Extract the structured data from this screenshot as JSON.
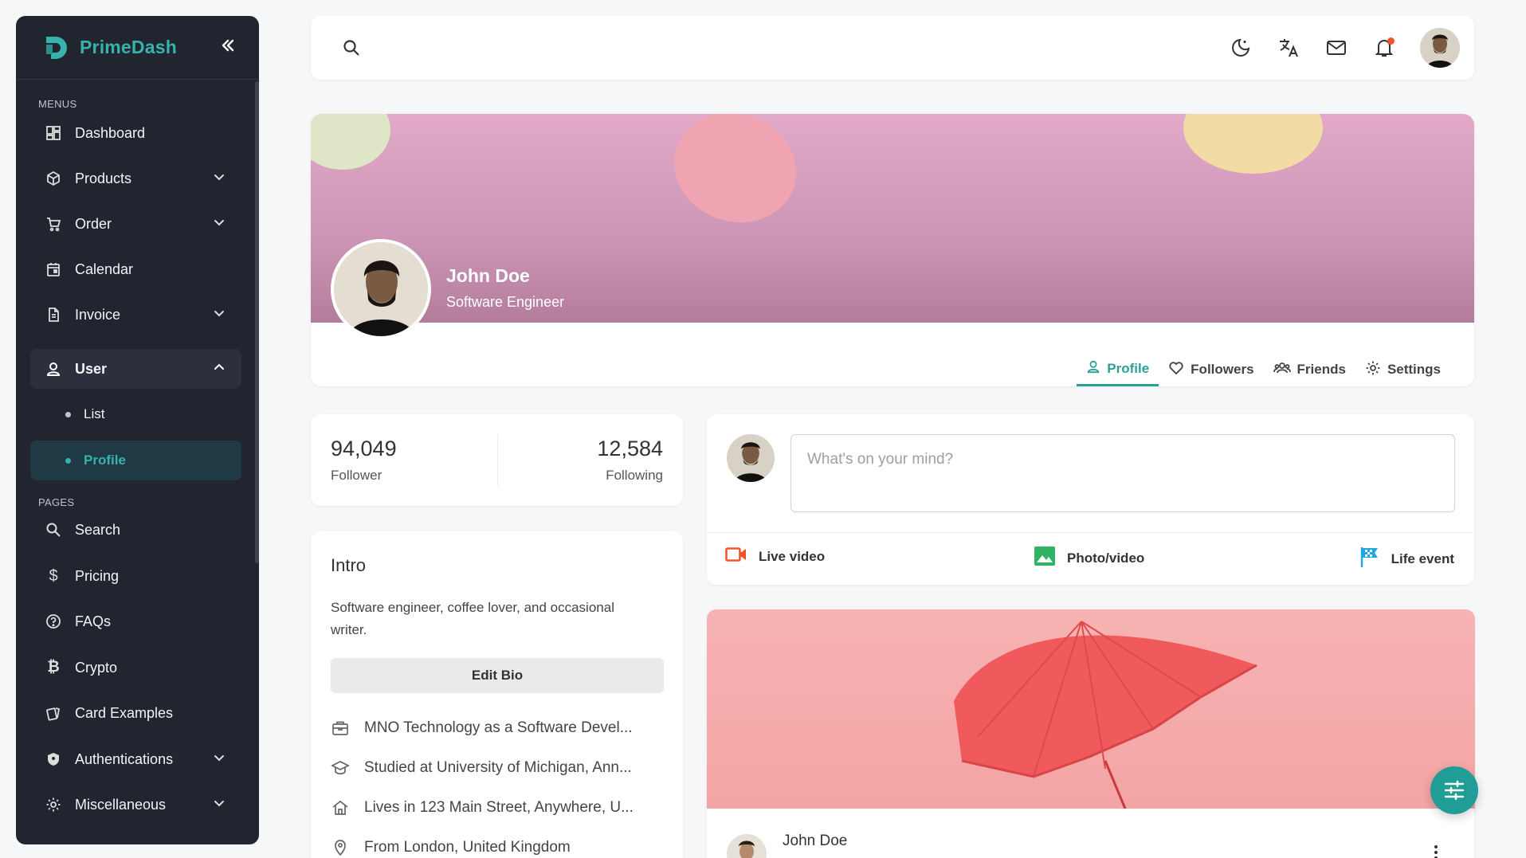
{
  "app": {
    "name": "PrimeDash"
  },
  "sidebar": {
    "sections": {
      "menus": "MENUS",
      "pages": "PAGES"
    },
    "items": [
      {
        "label": "Dashboard"
      },
      {
        "label": "Products"
      },
      {
        "label": "Order"
      },
      {
        "label": "Calendar"
      },
      {
        "label": "Invoice"
      },
      {
        "label": "User"
      },
      {
        "label": "Search"
      },
      {
        "label": "Pricing"
      },
      {
        "label": "FAQs"
      },
      {
        "label": "Crypto"
      },
      {
        "label": "Card Examples"
      },
      {
        "label": "Authentications"
      },
      {
        "label": "Miscellaneous"
      }
    ],
    "user_sub": [
      {
        "label": "List"
      },
      {
        "label": "Profile"
      }
    ]
  },
  "profile": {
    "name": "John Doe",
    "role": "Software Engineer",
    "tabs": [
      {
        "label": "Profile"
      },
      {
        "label": "Followers"
      },
      {
        "label": "Friends"
      },
      {
        "label": "Settings"
      }
    ]
  },
  "stats": {
    "followers": {
      "value": "94,049",
      "label": "Follower"
    },
    "following": {
      "value": "12,584",
      "label": "Following"
    }
  },
  "intro": {
    "title": "Intro",
    "bio": "Software engineer, coffee lover, and occasional writer.",
    "edit_label": "Edit Bio",
    "details": [
      {
        "icon": "briefcase-icon",
        "text": "MNO Technology as a Software Devel..."
      },
      {
        "icon": "graduation-cap-icon",
        "text": "Studied at University of Michigan, Ann..."
      },
      {
        "icon": "home-icon",
        "text": "Lives in 123 Main Street, Anywhere, U..."
      },
      {
        "icon": "location-pin-icon",
        "text": "From London, United Kingdom"
      }
    ]
  },
  "composer": {
    "placeholder": "What's on your mind?",
    "actions": [
      {
        "label": "Live video"
      },
      {
        "label": "Photo/video"
      },
      {
        "label": "Life event"
      }
    ]
  },
  "post": {
    "author": "John Doe"
  },
  "colors": {
    "accent": "#2c9f99",
    "sidebar_bg": "#212530",
    "live_video": "#f2552c",
    "photo_video": "#2fb463",
    "life_event": "#1ea7e4",
    "notification_dot": "#f2552c"
  }
}
